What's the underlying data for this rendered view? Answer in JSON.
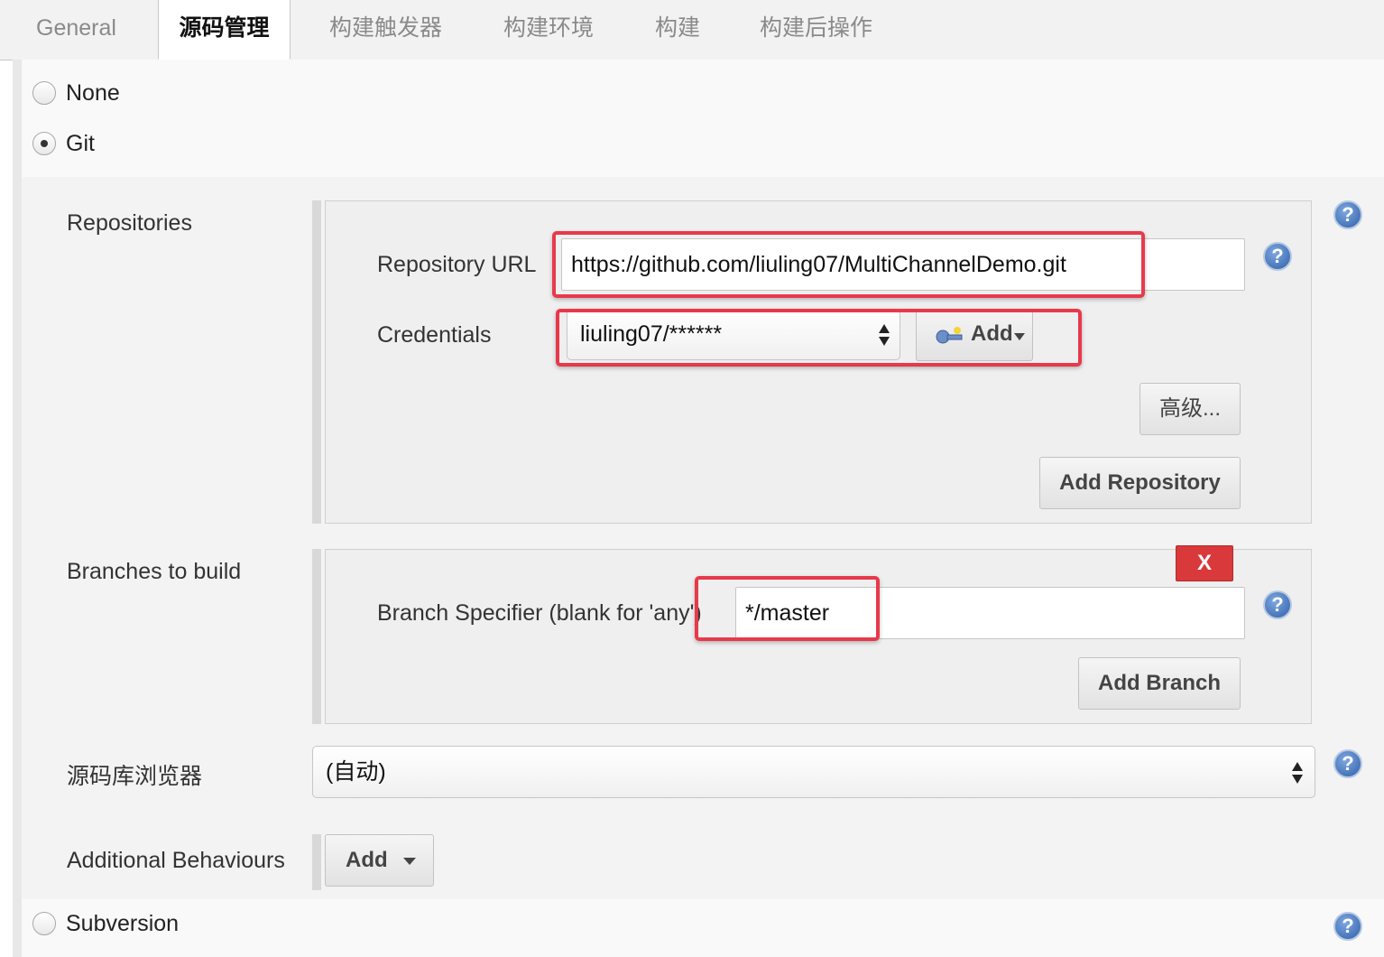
{
  "tabs": [
    {
      "label": "General",
      "active": false
    },
    {
      "label": "源码管理",
      "active": true
    },
    {
      "label": "构建触发器",
      "active": false
    },
    {
      "label": "构建环境",
      "active": false
    },
    {
      "label": "构建",
      "active": false
    },
    {
      "label": "构建后操作",
      "active": false
    }
  ],
  "scm": {
    "options": {
      "none": "None",
      "git": "Git",
      "subversion": "Subversion"
    },
    "selected": "Git"
  },
  "repositories": {
    "label": "Repositories",
    "url_label": "Repository URL",
    "url_value": "https://github.com/liuling07/MultiChannelDemo.git",
    "credentials_label": "Credentials",
    "credentials_value": "liuling07/******",
    "add_credentials_label": "Add",
    "advanced_button": "高级...",
    "add_repository_button": "Add Repository"
  },
  "branches": {
    "label": "Branches to build",
    "delete_button": "X",
    "specifier_label": "Branch Specifier (blank for 'any')",
    "specifier_value": "*/master",
    "add_branch_button": "Add Branch"
  },
  "browser": {
    "label": "源码库浏览器",
    "value": "(自动)"
  },
  "behaviours": {
    "label": "Additional Behaviours",
    "add_button": "Add"
  },
  "help_icon_text": "?",
  "colors": {
    "highlight": "#e8394b",
    "delete_button": "#d9393a",
    "help_icon": "#2f5fa8"
  }
}
